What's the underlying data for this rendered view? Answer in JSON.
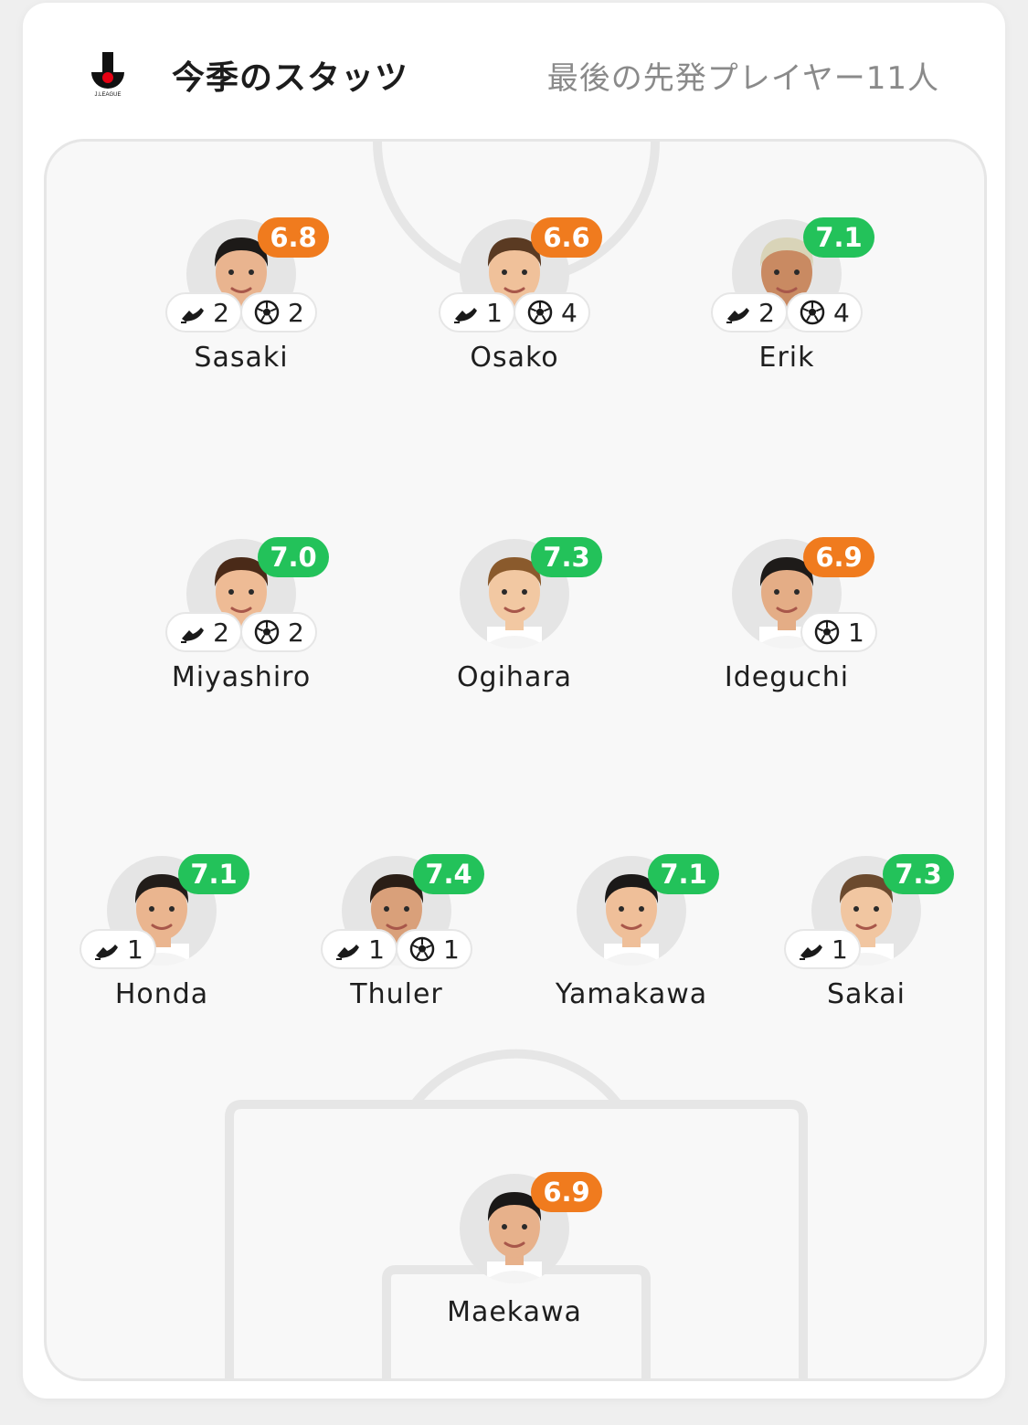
{
  "header": {
    "logo_text": "J.LEAGUE",
    "title": "今季のスタッツ",
    "subtitle": "最後の先発プレイヤー11人"
  },
  "colors": {
    "rating_orange": "#f07b1e",
    "rating_green": "#23c25a",
    "pitch_bg": "#f8f8f8",
    "pitch_lines": "#e6e6e6",
    "logo_red": "#e60012"
  },
  "icons": {
    "assists": "boot-icon",
    "goals": "soccer-ball-icon"
  },
  "players": [
    {
      "id": "sasaki",
      "name": "Sasaki",
      "rating": "6.8",
      "rating_color": "orange",
      "assists": "2",
      "goals": "2"
    },
    {
      "id": "osako",
      "name": "Osako",
      "rating": "6.6",
      "rating_color": "orange",
      "assists": "1",
      "goals": "4"
    },
    {
      "id": "erik",
      "name": "Erik",
      "rating": "7.1",
      "rating_color": "green",
      "assists": "2",
      "goals": "4"
    },
    {
      "id": "miyashiro",
      "name": "Miyashiro",
      "rating": "7.0",
      "rating_color": "green",
      "assists": "2",
      "goals": "2"
    },
    {
      "id": "ogihara",
      "name": "Ogihara",
      "rating": "7.3",
      "rating_color": "green",
      "assists": null,
      "goals": null
    },
    {
      "id": "ideguchi",
      "name": "Ideguchi",
      "rating": "6.9",
      "rating_color": "orange",
      "assists": null,
      "goals": "1"
    },
    {
      "id": "honda",
      "name": "Honda",
      "rating": "7.1",
      "rating_color": "green",
      "assists": "1",
      "goals": null
    },
    {
      "id": "thuler",
      "name": "Thuler",
      "rating": "7.4",
      "rating_color": "green",
      "assists": "1",
      "goals": "1"
    },
    {
      "id": "yamakawa",
      "name": "Yamakawa",
      "rating": "7.1",
      "rating_color": "green",
      "assists": null,
      "goals": null
    },
    {
      "id": "sakai",
      "name": "Sakai",
      "rating": "7.3",
      "rating_color": "green",
      "assists": "1",
      "goals": null
    },
    {
      "id": "maekawa",
      "name": "Maekawa",
      "rating": "6.9",
      "rating_color": "orange",
      "assists": null,
      "goals": null
    }
  ]
}
